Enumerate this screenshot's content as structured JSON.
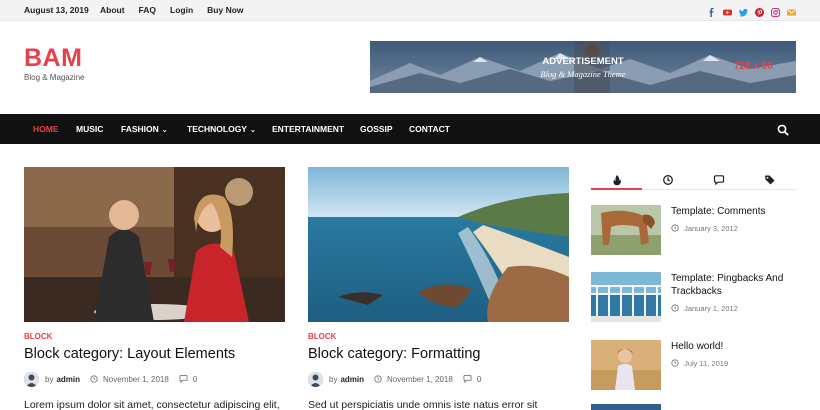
{
  "topbar": {
    "date": "August 13, 2019",
    "links": [
      "About",
      "FAQ",
      "Login",
      "Buy Now"
    ],
    "social": [
      {
        "name": "facebook-icon",
        "color": "#3b5998"
      },
      {
        "name": "youtube-icon",
        "color": "#e52d27"
      },
      {
        "name": "twitter-icon",
        "color": "#1da1f2"
      },
      {
        "name": "pinterest-icon",
        "color": "#cb2027"
      },
      {
        "name": "instagram-icon",
        "color": "#c13584"
      },
      {
        "name": "email-icon",
        "color": "#f0a830"
      }
    ]
  },
  "header": {
    "logo": "BAM",
    "tagline": "Blog & Magazine",
    "ad": {
      "title": "ADVERTISEMENT",
      "subtitle": "Blog & Magazine Theme",
      "size": "728 x 90"
    }
  },
  "nav": {
    "items": [
      {
        "label": "HOME",
        "active": true
      },
      {
        "label": "MUSIC"
      },
      {
        "label": "FASHION",
        "dropdown": true
      },
      {
        "label": "TECHNOLOGY",
        "dropdown": true
      },
      {
        "label": "ENTERTAINMENT"
      },
      {
        "label": "GOSSIP"
      },
      {
        "label": "CONTACT"
      }
    ],
    "caret": "⌄"
  },
  "posts": [
    {
      "category": "BLOCK",
      "title": "Block category: Layout Elements",
      "by": "by",
      "author": "admin",
      "date": "November 1, 2018",
      "comments": "0",
      "excerpt": "Lorem ipsum dolor sit amet, consectetur adipiscing elit,"
    },
    {
      "category": "BLOCK",
      "title": "Block category: Formatting",
      "by": "by",
      "author": "admin",
      "date": "November 1, 2018",
      "comments": "0",
      "excerpt": "Sed ut perspiciatis unde omnis iste natus error sit"
    }
  ],
  "sidebar": {
    "tabs": [
      "flame-icon",
      "clock-icon",
      "comments-icon",
      "tags-icon"
    ],
    "items": [
      {
        "title": "Template: Comments",
        "date": "January 3, 2012"
      },
      {
        "title": "Template: Pingbacks And Trackbacks",
        "date": "January 1, 2012"
      },
      {
        "title": "Hello world!",
        "date": "July 11, 2019"
      }
    ]
  },
  "colors": {
    "accent": "#e5424c",
    "nav_bg": "#111111"
  }
}
